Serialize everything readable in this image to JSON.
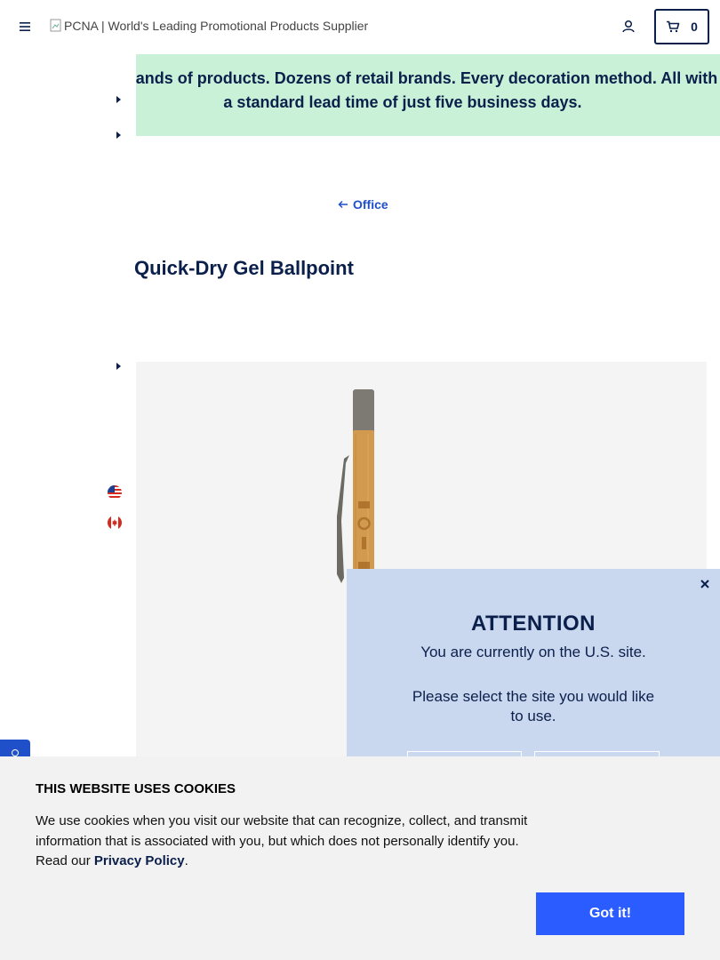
{
  "header": {
    "logo_alt": "PCNA | World's Leading Promotional Products Supplier",
    "cart_count": "0"
  },
  "banner": {
    "text": "Thousands of products. Dozens of retail brands. Every decoration method. All with a standard lead time of just five business days."
  },
  "breadcrumb": {
    "back_label": "Office"
  },
  "product": {
    "title": "Quick-Dry Gel Ballpoint"
  },
  "modal": {
    "title": "ATTENTION",
    "message": "You are currently on the U.S. site.",
    "prompt": "Please select the site you would like to use."
  },
  "cookie": {
    "title": "THIS WEBSITE USES COOKIES",
    "text": "We use cookies when you visit our website that can recognize, collect, and transmit information that is associated with you, but which does not personally identify you. Read our ",
    "policy_link": "Privacy Policy",
    "period": ".",
    "button": "Got it!"
  },
  "colors": {
    "navy": "#0b1f4b",
    "banner_bg": "#c9f1d8",
    "modal_bg": "#c9d7ef",
    "accent_blue": "#2a5cff"
  },
  "icons": [
    "menu-icon",
    "account-icon",
    "cart-icon",
    "caret-right-icon",
    "arrow-left-icon",
    "us-flag-icon",
    "canada-flag-icon",
    "close-icon"
  ]
}
